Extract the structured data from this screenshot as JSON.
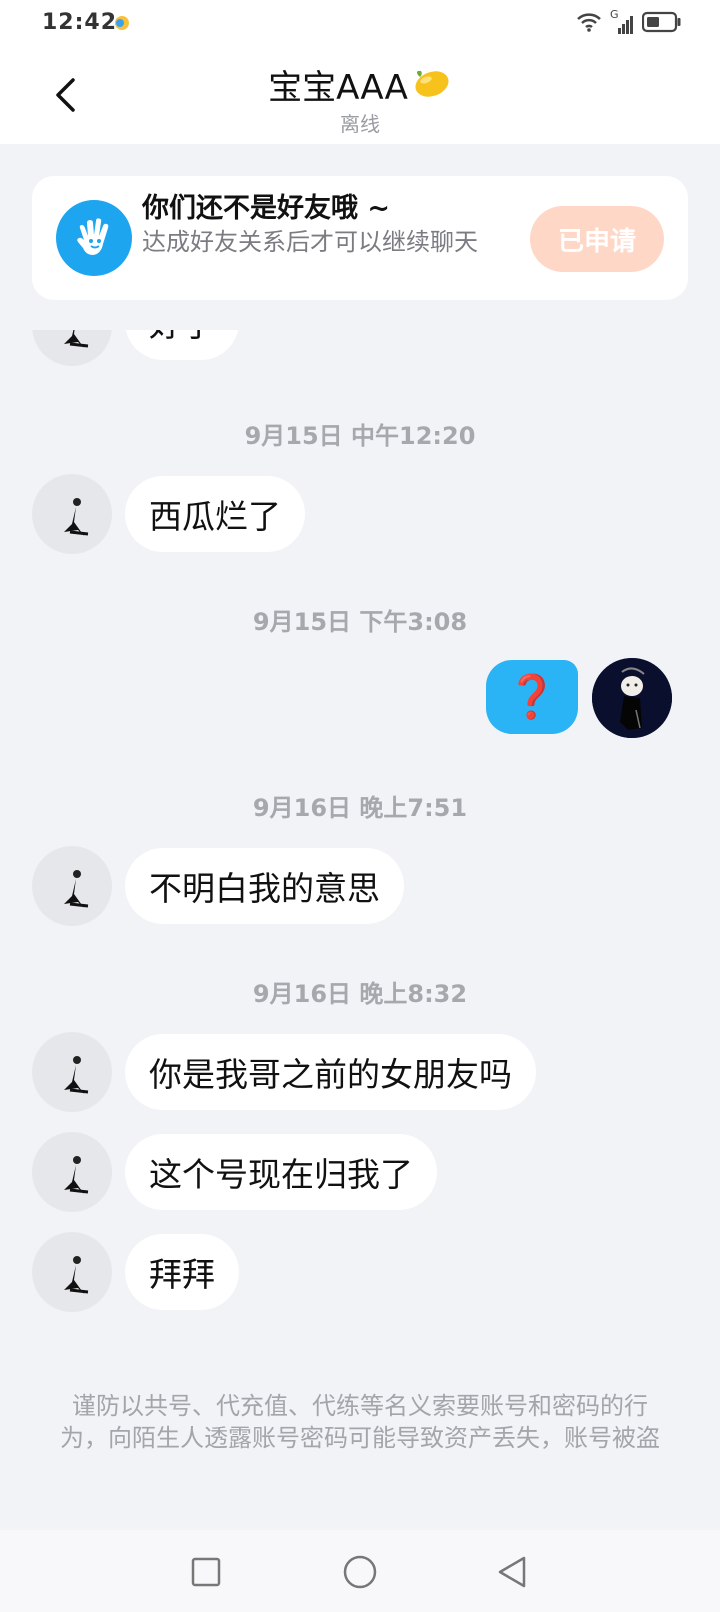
{
  "status_bar": {
    "time": "12:42",
    "signal_label": "G"
  },
  "header": {
    "title": "宝宝AAA",
    "title_emoji": "🍋",
    "status": "离线"
  },
  "friend_banner": {
    "title": "你们还不是好友哦 ~",
    "description": "达成好友关系后才可以继续聊天",
    "button_label": "已申请"
  },
  "messages": [
    {
      "type": "received",
      "text": "好了"
    },
    {
      "type": "timestamp",
      "text": "9月15日 中午12:20"
    },
    {
      "type": "received",
      "text": "西瓜烂了"
    },
    {
      "type": "timestamp",
      "text": "9月15日 下午3:08"
    },
    {
      "type": "sent",
      "text": "❓"
    },
    {
      "type": "timestamp",
      "text": "9月16日 晚上7:51"
    },
    {
      "type": "received",
      "text": "不明白我的意思"
    },
    {
      "type": "timestamp",
      "text": "9月16日 晚上8:32"
    },
    {
      "type": "received",
      "text": "你是我哥之前的女朋友吗"
    },
    {
      "type": "received",
      "text": "这个号现在归我了"
    },
    {
      "type": "received",
      "text": "拜拜"
    }
  ],
  "warning": "谨防以共号、代充值、代练等名义索要账号和密码的行为，向陌生人透露账号密码可能导致资产丢失，账号被盗",
  "colors": {
    "self_bubble": "#2bb4f5",
    "applied_button": "#ffd7c7",
    "banner_icon": "#1da5f0"
  }
}
